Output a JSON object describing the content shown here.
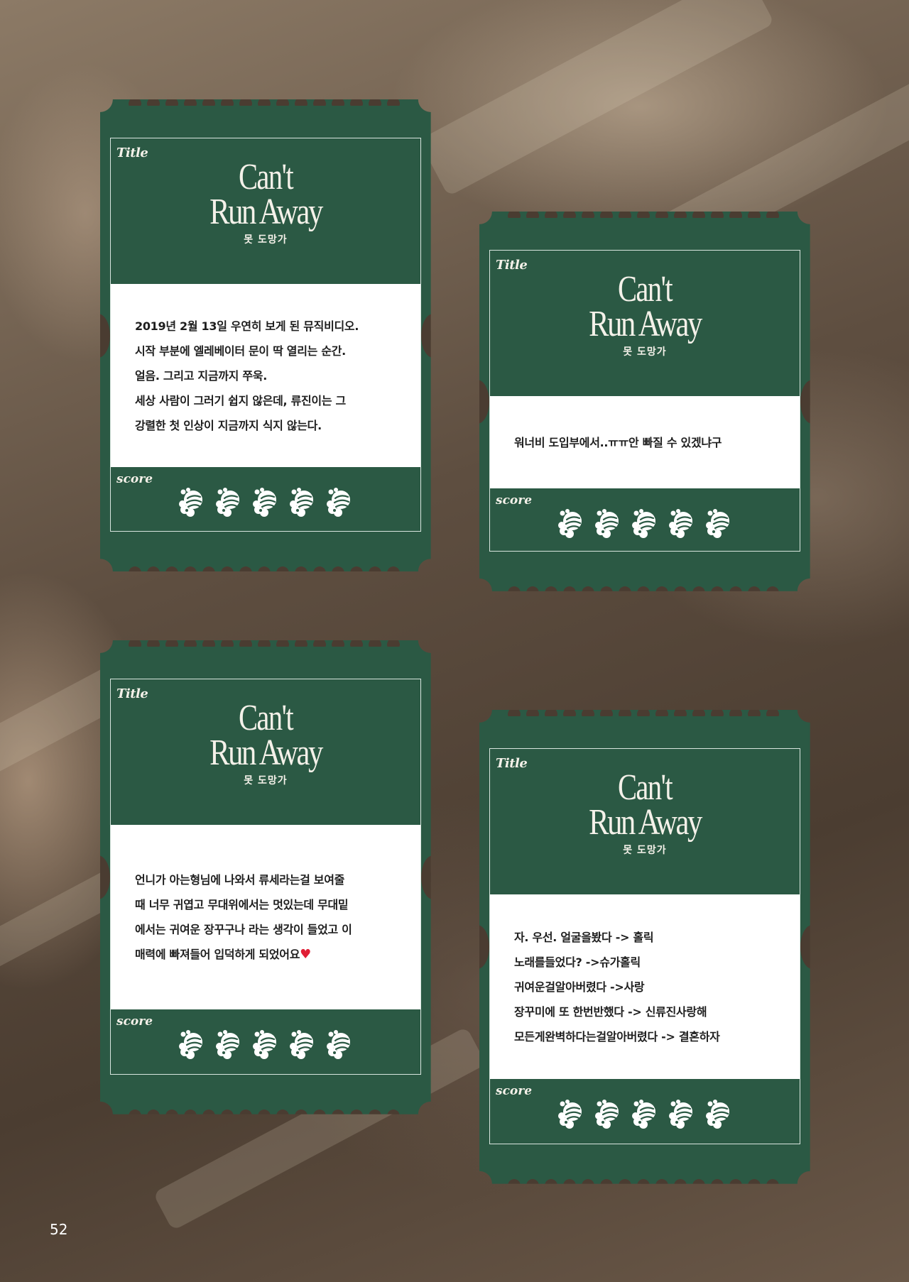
{
  "page_number": "52",
  "colors": {
    "ticket_green": "#2b5944",
    "frame_line": "#d9e6df",
    "text_dark": "#1e1e1e",
    "heart": "#e01e35"
  },
  "tickets": [
    {
      "title_label": "Title",
      "logo_line1": "Can't",
      "logo_line2": "Run Away",
      "logo_sub": "못 도망가",
      "score_label": "score",
      "icon": "strawberry-icon",
      "score": 5,
      "lines": [
        "2019년 2월 13일 우연히 보게 된 뮤직비디오.",
        "시작 부분에 엘레베이터 문이 딱 열리는 순간.",
        "얼음. 그리고 지금까지 쭈욱.",
        "세상 사람이 그러기 쉽지 않은데, 류진이는 그",
        "강렬한 첫 인상이 지금까지 식지 않는다."
      ]
    },
    {
      "title_label": "Title",
      "logo_line1": "Can't",
      "logo_line2": "Run Away",
      "logo_sub": "못 도망가",
      "score_label": "score",
      "icon": "strawberry-icon",
      "score": 5,
      "lines": [
        "워너비 도입부에서..ㅠㅠ안 빠질 수 있겠냐구"
      ]
    },
    {
      "title_label": "Title",
      "logo_line1": "Can't",
      "logo_line2": "Run Away",
      "logo_sub": "못 도망가",
      "score_label": "score",
      "icon": "strawberry-icon",
      "score": 5,
      "lines": [
        "언니가 아는형님에 나와서 류세라는걸 보여줄",
        "때 너무 귀엽고 무대위에서는 멋있는데 무대밑",
        "에서는 귀여운 장꾸구나 라는 생각이 들었고 이",
        "매력에 빠져들어 입덕하게 되었어요"
      ],
      "end_emoji": "♥"
    },
    {
      "title_label": "Title",
      "logo_line1": "Can't",
      "logo_line2": "Run Away",
      "logo_sub": "못 도망가",
      "score_label": "score",
      "icon": "strawberry-icon",
      "score": 5,
      "lines": [
        "자. 우선. 얼굴을봤다 -> 홀릭",
        "노래를들었다? ->슈가홀릭",
        "귀여운걸알아버렸다 ->사랑",
        "장꾸미에 또 한번반했다 -> 신류진사랑해",
        "모든게완벽하다는걸알아버렸다 -> 결혼하자"
      ]
    }
  ]
}
